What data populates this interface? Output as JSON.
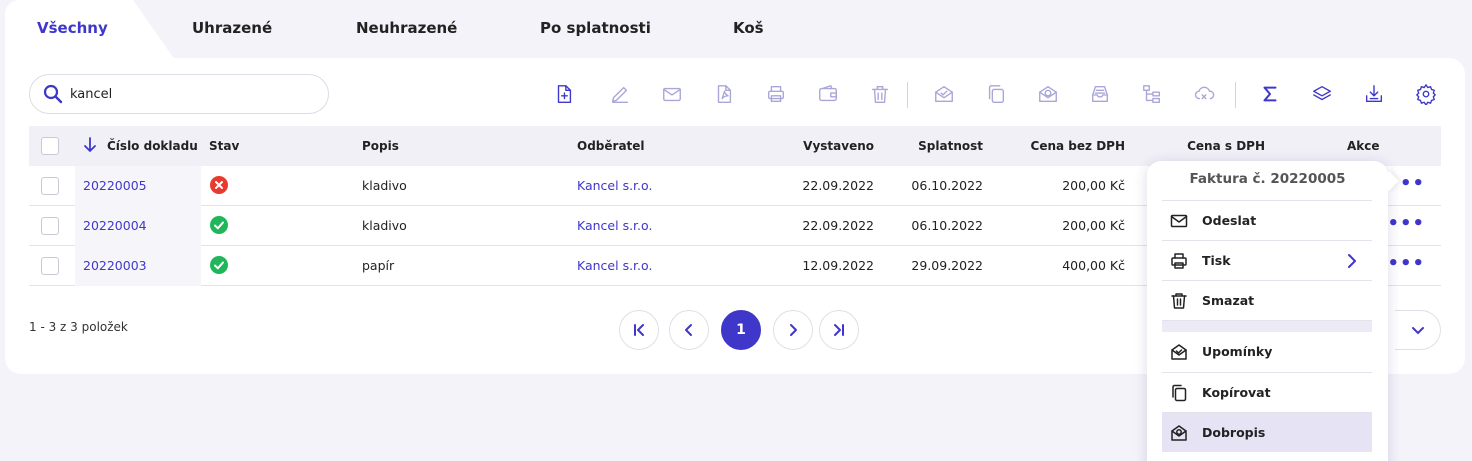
{
  "tabs": [
    {
      "label": "Všechny",
      "active": true
    },
    {
      "label": "Uhrazené"
    },
    {
      "label": "Neuhrazené"
    },
    {
      "label": "Po splatnosti"
    },
    {
      "label": "Koš"
    }
  ],
  "search": {
    "value": "kancel"
  },
  "toolbar": {
    "icons": [
      "new-document-icon",
      "edit-icon",
      "email-icon",
      "pdf-icon",
      "print-icon",
      "wallet-icon",
      "trash-icon",
      "reminder-icon",
      "copy-icon",
      "credit-note-icon",
      "archive-icon",
      "tree-icon",
      "cloud-sync-icon",
      "sum-icon",
      "layers-icon",
      "download-icon",
      "settings-icon"
    ]
  },
  "table": {
    "headers": {
      "number": "Číslo dokladu",
      "status": "Stav",
      "description": "Popis",
      "customer": "Odběratel",
      "issued": "Vystaveno",
      "due": "Splatnost",
      "price_net": "Cena bez DPH",
      "price_gross": "Cena s DPH",
      "actions": "Akce"
    },
    "rows": [
      {
        "number": "20220005",
        "status": "unpaid",
        "description": "kladivo",
        "customer": "Kancel s.r.o.",
        "issued": "22.09.2022",
        "due": "06.10.2022",
        "price_net": "200,00 Kč"
      },
      {
        "number": "20220004",
        "status": "paid",
        "description": "kladivo",
        "customer": "Kancel s.r.o.",
        "issued": "22.09.2022",
        "due": "06.10.2022",
        "price_net": "200,00 Kč"
      },
      {
        "number": "20220003",
        "status": "paid",
        "description": "papír",
        "customer": "Kancel s.r.o.",
        "issued": "12.09.2022",
        "due": "29.09.2022",
        "price_net": "400,00 Kč"
      }
    ],
    "actions_label": "•••"
  },
  "footer": {
    "count": "1 - 3 z 3 položek",
    "current_page": "1"
  },
  "context_menu": {
    "title": "Faktura č. 20220005",
    "items": [
      {
        "label": "Odeslat",
        "icon": "mail-icon"
      },
      {
        "label": "Tisk",
        "icon": "print-icon",
        "submenu": true
      },
      {
        "label": "Smazat",
        "icon": "trash-icon"
      },
      {
        "label": "Upomínky",
        "icon": "reminder-icon"
      },
      {
        "label": "Kopírovat",
        "icon": "copy-icon"
      },
      {
        "label": "Dobropis",
        "icon": "credit-note-icon",
        "highlighted": true
      }
    ]
  },
  "colors": {
    "accent": "#3f37c9",
    "error": "#e83a2e",
    "success": "#1fb75a",
    "background": "#f4f3f9"
  }
}
